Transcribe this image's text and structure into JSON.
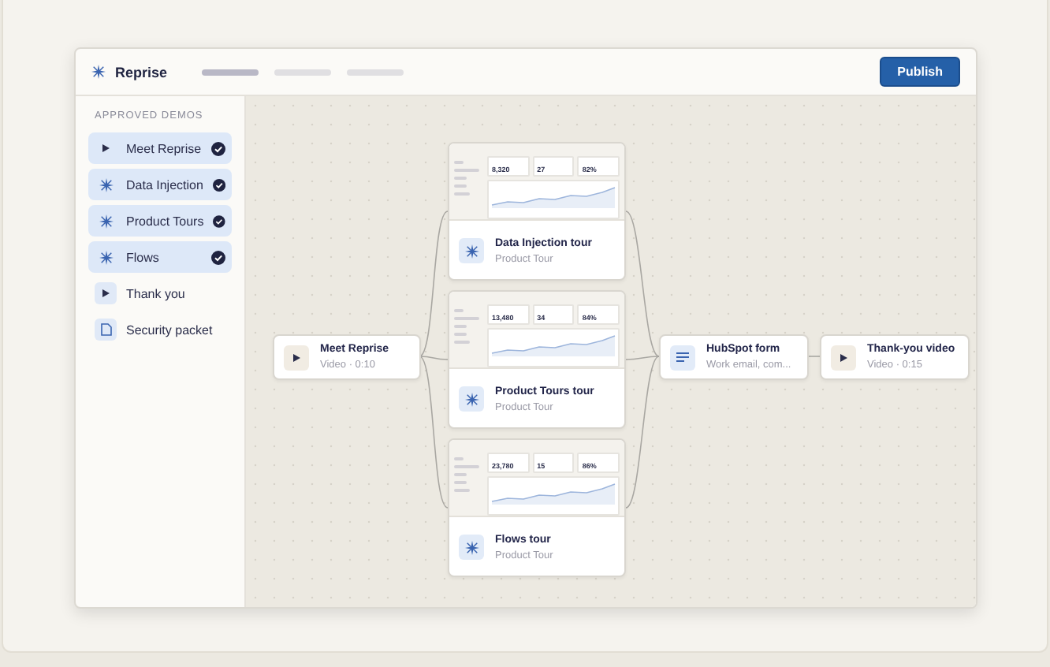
{
  "app": {
    "name": "Reprise",
    "publish": "Publish"
  },
  "sidebar": {
    "heading": "APPROVED DEMOS",
    "items": [
      {
        "label": "Meet Reprise",
        "kind": "video",
        "approved": true
      },
      {
        "label": "Data Injection",
        "kind": "tour",
        "approved": true
      },
      {
        "label": "Product Tours",
        "kind": "tour",
        "approved": true
      },
      {
        "label": "Flows",
        "kind": "tour",
        "approved": true
      },
      {
        "label": "Thank  you",
        "kind": "video",
        "approved": false
      },
      {
        "label": "Security packet",
        "kind": "document",
        "approved": false
      }
    ]
  },
  "flow": {
    "start": {
      "title": "Meet Reprise",
      "subtitle": "Video · 0:10",
      "kind": "video"
    },
    "tours": [
      {
        "title": "Data Injection tour",
        "subtitle": "Product Tour",
        "stats": [
          "8,320",
          "27",
          "82%"
        ]
      },
      {
        "title": "Product Tours  tour",
        "subtitle": "Product Tour",
        "stats": [
          "13,480",
          "34",
          "84%"
        ]
      },
      {
        "title": "Flows tour",
        "subtitle": "Product Tour",
        "stats": [
          "23,780",
          "15",
          "86%"
        ]
      }
    ],
    "form": {
      "title": "HubSpot form",
      "subtitle": "Work email, com...",
      "kind": "form"
    },
    "end": {
      "title": "Thank-you video",
      "subtitle": "Video · 0:15",
      "kind": "video"
    }
  }
}
